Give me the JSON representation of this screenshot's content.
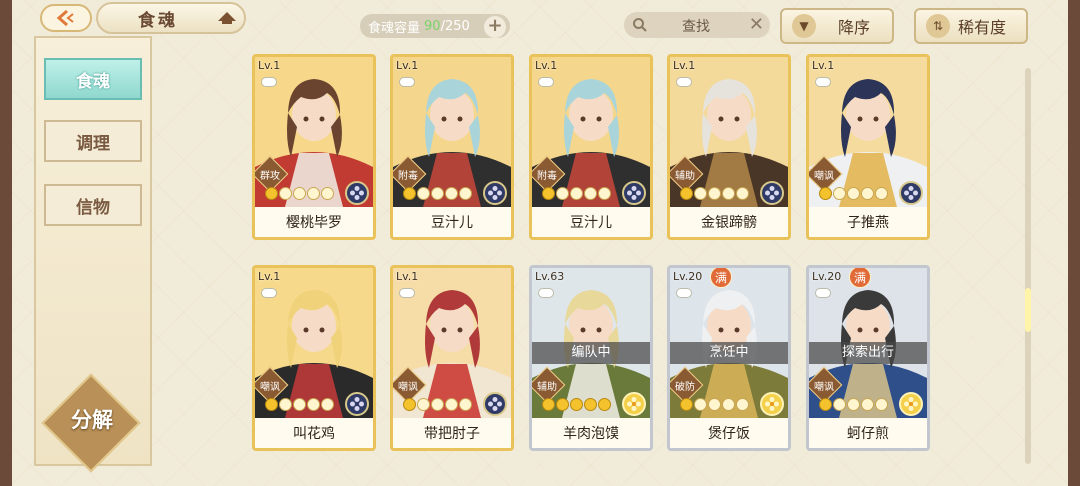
{
  "header": {
    "title": "食魂",
    "capacity_label": "食魂容量",
    "capacity_current": "90",
    "capacity_max": "/250",
    "capacity_add": "+",
    "search_placeholder": "查找",
    "search_clear": "✕",
    "sort_order_label": "降序",
    "sort_by_label": "稀有度"
  },
  "sidebar": {
    "items": [
      {
        "label": "食魂",
        "active": true
      },
      {
        "label": "调理",
        "active": false
      },
      {
        "label": "信物",
        "active": false
      }
    ],
    "decompose_label": "分解"
  },
  "cards": [
    {
      "name": "樱桃毕罗",
      "level": "Lv.1",
      "role": "群攻",
      "stars_on": 1,
      "frame": "gold",
      "element": "dark",
      "status": "",
      "full": false,
      "palette": {
        "bg": "#f7d88a",
        "hair": "#6b4430",
        "cloth": "#c23b32",
        "accent": "#f2f2ea"
      }
    },
    {
      "name": "豆汁儿",
      "level": "Lv.1",
      "role": "附毒",
      "stars_on": 1,
      "frame": "gold",
      "element": "dark",
      "status": "",
      "full": false,
      "palette": {
        "bg": "#f4d68c",
        "hair": "#a9d4da",
        "cloth": "#2f2f2f",
        "accent": "#c8463a"
      }
    },
    {
      "name": "豆汁儿",
      "level": "Lv.1",
      "role": "附毒",
      "stars_on": 1,
      "frame": "gold",
      "element": "dark",
      "status": "",
      "full": false,
      "palette": {
        "bg": "#f4d68c",
        "hair": "#a9d4da",
        "cloth": "#2f2f2f",
        "accent": "#c8463a"
      }
    },
    {
      "name": "金银蹄髈",
      "level": "Lv.1",
      "role": "辅助",
      "stars_on": 1,
      "frame": "gold",
      "element": "dark",
      "status": "",
      "full": false,
      "palette": {
        "bg": "#f3d99a",
        "hair": "#e6e2dc",
        "cloth": "#4a3626",
        "accent": "#b2874a"
      }
    },
    {
      "name": "子推燕",
      "level": "Lv.1",
      "role": "嘲讽",
      "stars_on": 1,
      "frame": "gold",
      "element": "dark",
      "status": "",
      "full": false,
      "palette": {
        "bg": "#f5dc9e",
        "hair": "#2c3458",
        "cloth": "#eef0f2",
        "accent": "#e2b246"
      }
    },
    {
      "name": "叫花鸡",
      "level": "Lv.1",
      "role": "嘲讽",
      "stars_on": 1,
      "frame": "gold",
      "element": "dark",
      "status": "",
      "full": false,
      "palette": {
        "bg": "#f6d98a",
        "hair": "#f0d27a",
        "cloth": "#2a2a2a",
        "accent": "#c53a3a"
      }
    },
    {
      "name": "带把肘子",
      "level": "Lv.1",
      "role": "嘲讽",
      "stars_on": 1,
      "frame": "gold",
      "element": "dark",
      "status": "",
      "full": false,
      "palette": {
        "bg": "#f6dca6",
        "hair": "#b03a3a",
        "cloth": "#f1e6d2",
        "accent": "#c8302a"
      }
    },
    {
      "name": "羊肉泡馍",
      "level": "Lv.63",
      "role": "辅助",
      "stars_on": 5,
      "frame": "silver",
      "element": "yellow",
      "status": "编队中",
      "full": false,
      "palette": {
        "bg": "#dfe6ea",
        "hair": "#e8d89a",
        "cloth": "#6a7a3a",
        "accent": "#f2f0ea"
      }
    },
    {
      "name": "煲仔饭",
      "level": "Lv.20",
      "role": "破防",
      "stars_on": 1,
      "frame": "silver",
      "element": "yellow",
      "status": "烹饪中",
      "full": true,
      "palette": {
        "bg": "#dde4ea",
        "hair": "#eef0f2",
        "cloth": "#7d7b3a",
        "accent": "#d9b55a"
      }
    },
    {
      "name": "蚵仔煎",
      "level": "Lv.20",
      "role": "嘲讽",
      "stars_on": 1,
      "frame": "silver",
      "element": "yellow",
      "status": "探索出行",
      "full": true,
      "palette": {
        "bg": "#dde3e8",
        "hair": "#3a3a3a",
        "cloth": "#2f4f8a",
        "accent": "#d8c28a"
      }
    }
  ],
  "full_badge_text": "满"
}
